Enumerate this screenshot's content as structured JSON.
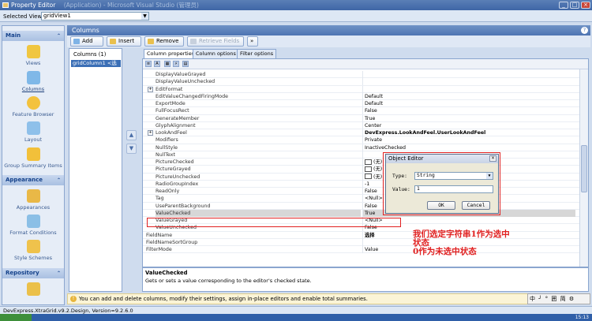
{
  "window": {
    "title": "Property Editor",
    "title_blurred": "(Application) - Microsoft Visual Studio (管理员)"
  },
  "selected_view": {
    "label": "Selected View :",
    "value": "gridView1"
  },
  "nav": {
    "main_label": "Main",
    "main_items": [
      "Views",
      "Columns",
      "Feature Browser",
      "Layout",
      "Group Summary Items"
    ],
    "appearance_label": "Appearance",
    "appearance_items": [
      "Appearances",
      "Format Conditions",
      "Style Schemes"
    ],
    "repository_label": "Repository"
  },
  "header": {
    "title": "Columns"
  },
  "toolbar": {
    "add": "Add",
    "insert": "Insert",
    "remove": "Remove",
    "retrieve": "Retrieve Fields",
    "more": "»"
  },
  "columns_list": {
    "title": "Columns (1)",
    "item": "gridColumn1 <选择>"
  },
  "tabs": [
    "Column properties",
    "Column options",
    "Filter options"
  ],
  "grid_rows": [
    {
      "name": "DisplayValueGrayed",
      "value": ""
    },
    {
      "name": "DisplayValueUnchecked",
      "value": ""
    },
    {
      "name": "EditFormat",
      "value": "",
      "expand": true
    },
    {
      "name": "EditValueChangedFiringMode",
      "value": "Default"
    },
    {
      "name": "ExportMode",
      "value": "Default"
    },
    {
      "name": "FullFocusRect",
      "value": "False"
    },
    {
      "name": "GenerateMember",
      "value": "True"
    },
    {
      "name": "GlyphAlignment",
      "value": "Center"
    },
    {
      "name": "LookAndFeel",
      "value": "DevExpress.LookAndFeel.UserLookAndFeel",
      "expand": true,
      "bold": true
    },
    {
      "name": "Modifiers",
      "value": "Private"
    },
    {
      "name": "NullStyle",
      "value": "InactiveChecked"
    },
    {
      "name": "NullText",
      "value": ""
    },
    {
      "name": "PictureChecked",
      "value": "(无)",
      "check": true
    },
    {
      "name": "PictureGrayed",
      "value": "(无)",
      "check": true
    },
    {
      "name": "PictureUnchecked",
      "value": "(无)",
      "check": true
    },
    {
      "name": "RadioGroupIndex",
      "value": "-1"
    },
    {
      "name": "ReadOnly",
      "value": "False"
    },
    {
      "name": "Tag",
      "value": "<Null>"
    },
    {
      "name": "UseParentBackground",
      "value": "False"
    },
    {
      "name": "ValueChecked",
      "value": "True",
      "highlight": true
    },
    {
      "name": "ValueGrayed",
      "value": "<Null>"
    },
    {
      "name": "ValueUnchecked",
      "value": "False"
    },
    {
      "name": "FieldName",
      "value": "选择",
      "bold": true,
      "top": true
    },
    {
      "name": "FieldNameSortGroup",
      "value": "",
      "top": true
    },
    {
      "name": "FilterMode",
      "value": "Value",
      "top": true
    }
  ],
  "description": {
    "title": "ValueChecked",
    "text": "Gets or sets a value corresponding to the editor's checked state."
  },
  "hint": "You can add and delete columns, modify their settings, assign in-place editors and enable total summaries.",
  "status": "DevExpress.XtraGrid.v9.2.Design, Version=9.2.6.0",
  "clock": "15:13",
  "ime": "中 ╯ ° 囲 简 ⚙",
  "dialog": {
    "title": "Object Editor",
    "type_label": "Type:",
    "type_value": "String",
    "value_label": "Value:",
    "value_value": "1",
    "ok": "OK",
    "cancel": "Cancel"
  },
  "annotation": {
    "line1": "我们选定字符串1作为选中",
    "line2": "状态",
    "line3": "0作为未选中状态"
  },
  "colors": {
    "accent": "#4d74b2",
    "annotation": "#e02020"
  }
}
